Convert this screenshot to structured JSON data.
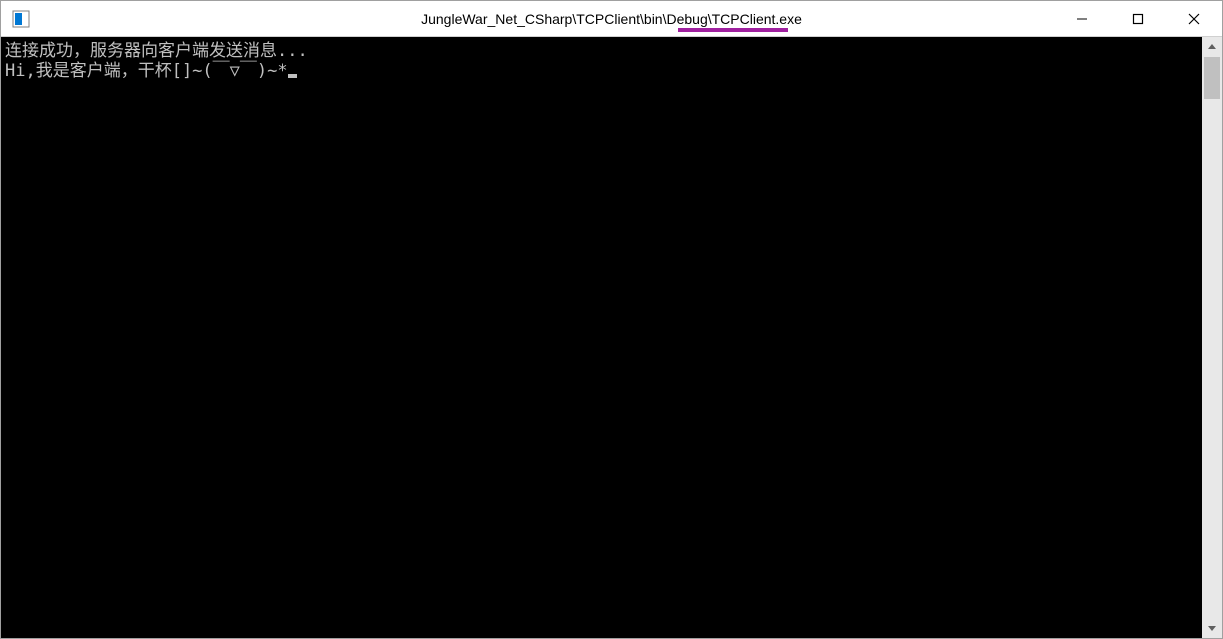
{
  "window": {
    "title": "JungleWar_Net_CSharp\\TCPClient\\bin\\Debug\\TCPClient.exe"
  },
  "console": {
    "lines": [
      "连接成功，服务器向客户端发送消息...",
      "Hi,我是客户端，干杯[]~(￣▽￣)~*"
    ]
  }
}
